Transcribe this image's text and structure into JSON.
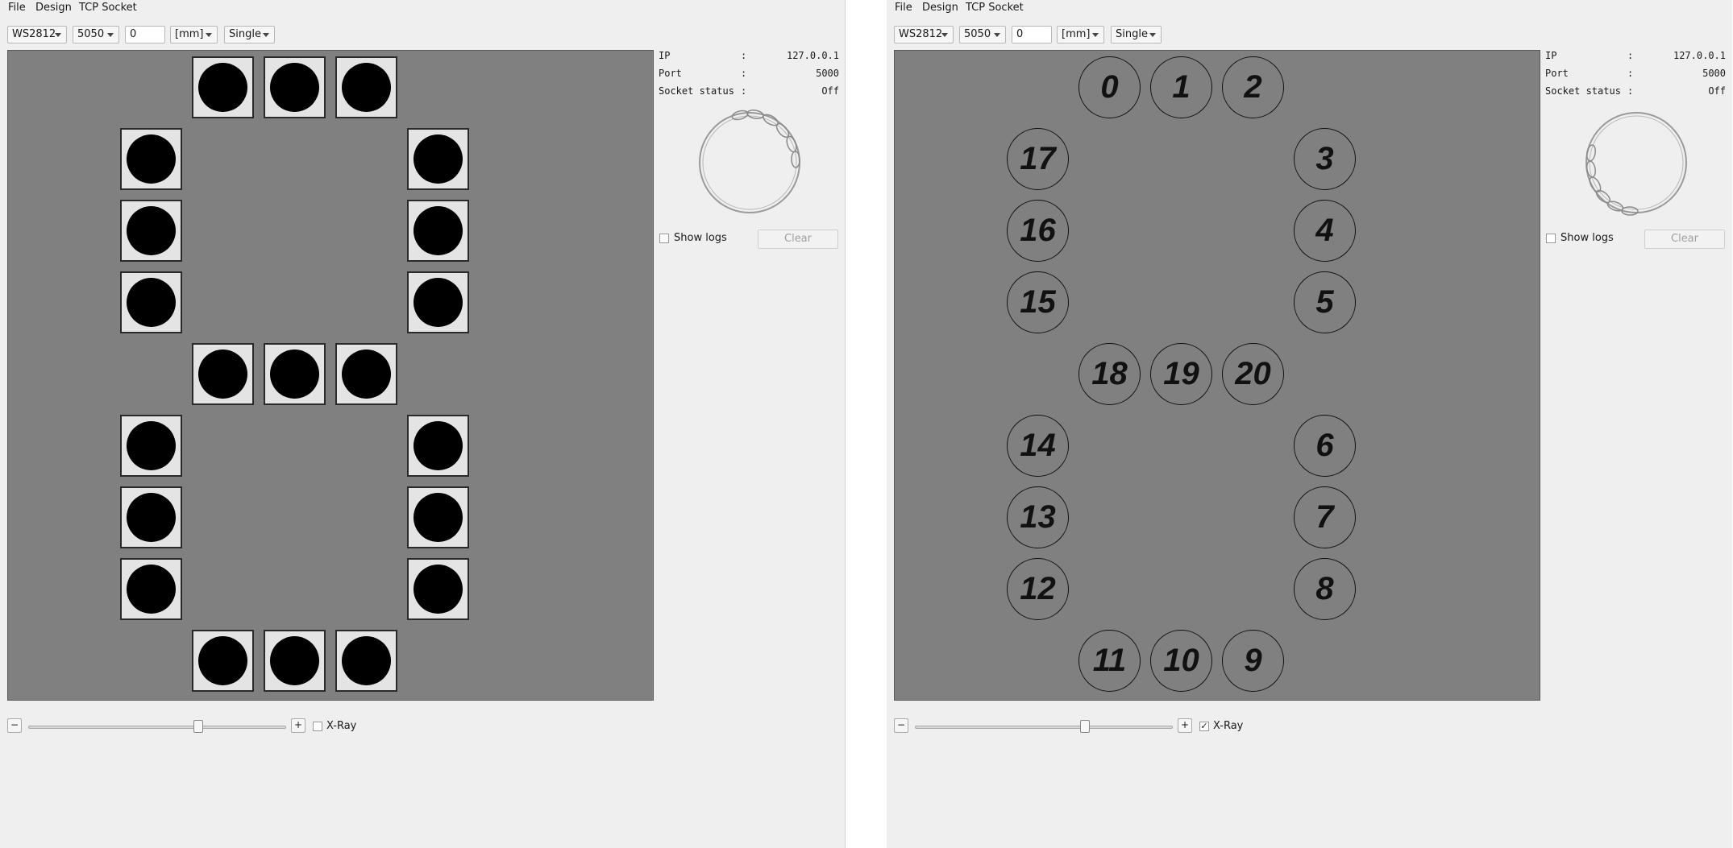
{
  "windows": [
    {
      "id": "left",
      "menu": [
        "File",
        "Design",
        "TCP Socket"
      ],
      "toolbar": {
        "led_type": "WS2812",
        "package": "5050",
        "offset_value": "0",
        "unit": "[mm]",
        "mode": "Single"
      },
      "info": {
        "ip_label": "IP",
        "ip_value": "127.0.0.1",
        "port_label": "Port",
        "port_value": "5000",
        "status_label": "Socket status",
        "status_value": "Off",
        "colon": ":"
      },
      "show_logs_label": "Show logs",
      "show_logs_checked": false,
      "clear_label": "Clear",
      "zoom_minus": "−",
      "zoom_plus": "+",
      "zoom_level": 0.66,
      "xray_label": "X-Ray",
      "xray_checked": false,
      "leds": [
        "",
        "",
        "",
        "",
        "",
        "",
        "",
        "",
        "",
        "",
        "",
        "",
        "",
        "",
        "",
        "",
        "",
        "",
        "",
        "",
        ""
      ]
    },
    {
      "id": "right",
      "menu": [
        "File",
        "Design",
        "TCP Socket"
      ],
      "toolbar": {
        "led_type": "WS2812",
        "package": "5050",
        "offset_value": "0",
        "unit": "[mm]",
        "mode": "Single"
      },
      "info": {
        "ip_label": "IP",
        "ip_value": "127.0.0.1",
        "port_label": "Port",
        "port_value": "5000",
        "status_label": "Socket status",
        "status_value": "Off",
        "colon": ":"
      },
      "show_logs_label": "Show logs",
      "show_logs_checked": false,
      "clear_label": "Clear",
      "zoom_minus": "−",
      "zoom_plus": "+",
      "zoom_level": 0.66,
      "xray_label": "X-Ray",
      "xray_checked": true,
      "xray_checkmark": "✓",
      "leds": [
        "0",
        "1",
        "2",
        "17",
        "3",
        "16",
        "4",
        "15",
        "5",
        "18",
        "19",
        "20",
        "14",
        "6",
        "13",
        "7",
        "12",
        "8",
        "11",
        "10",
        "9"
      ]
    }
  ],
  "colors": {
    "canvas_bg": "#808080",
    "window_bg": "#efefef",
    "led_dot": "#000000",
    "led_body": "#e4e4e4"
  }
}
